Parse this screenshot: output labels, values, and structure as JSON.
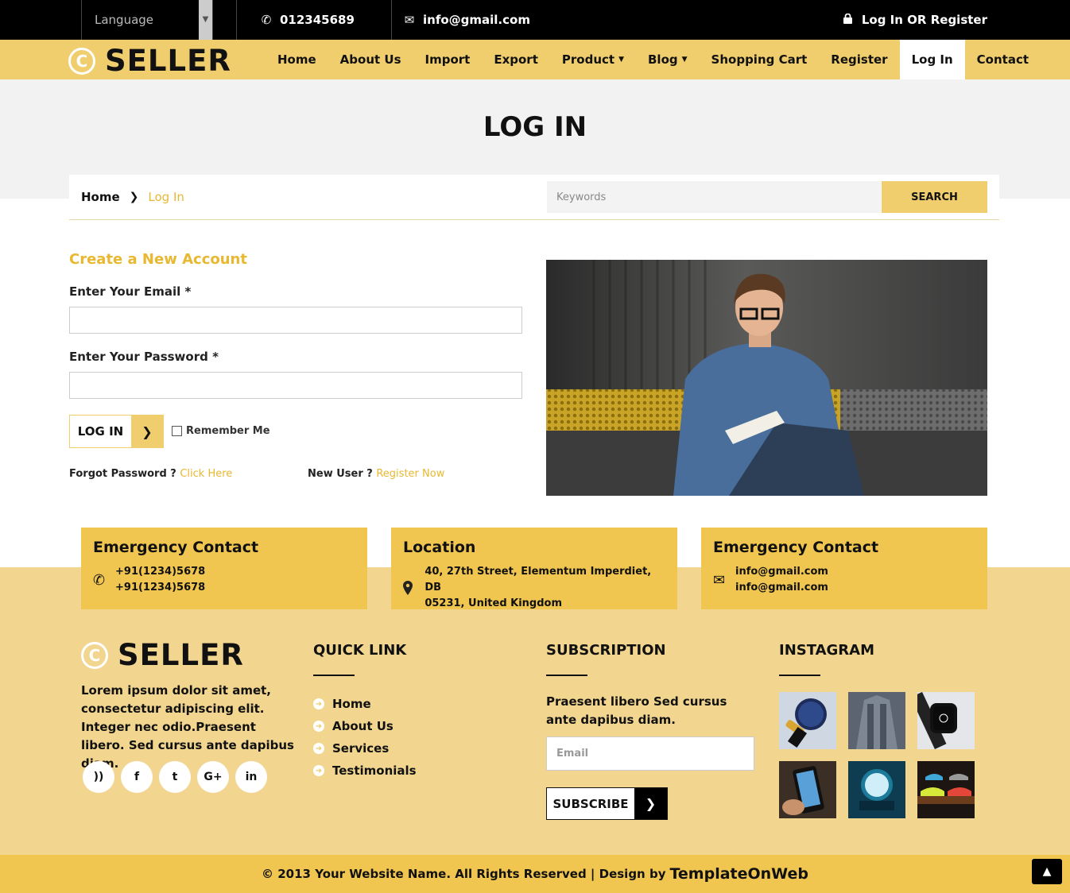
{
  "topbar": {
    "language_label": "Language",
    "phone": "012345689",
    "email": "info@gmail.com",
    "login_text": "Log In",
    "or_text": "OR",
    "register_text": "Register"
  },
  "brand": {
    "name": "SELLER",
    "mark": "C"
  },
  "nav": {
    "items": [
      {
        "label": "Home"
      },
      {
        "label": "About Us"
      },
      {
        "label": "Import"
      },
      {
        "label": "Export"
      },
      {
        "label": "Product"
      },
      {
        "label": "Blog"
      },
      {
        "label": "Shopping Cart"
      },
      {
        "label": "Register"
      },
      {
        "label": "Log In"
      },
      {
        "label": "Contact"
      }
    ]
  },
  "hero": {
    "title": "LOG IN"
  },
  "breadcrumb": {
    "home": "Home",
    "current": "Log In"
  },
  "search": {
    "placeholder": "Keywords",
    "button": "SEARCH"
  },
  "form": {
    "title": "Create a New Account",
    "email_label": "Enter Your Email",
    "password_label": "Enter Your Password",
    "required_mark": "*",
    "email_value": "",
    "password_value": "",
    "login_button": "LOG IN",
    "remember_label": "Remember Me",
    "forgot_text": "Forgot Password ?",
    "forgot_link": "Click Here",
    "new_user_text": "New User ?",
    "register_link": "Register Now"
  },
  "contact_cards": [
    {
      "title": "Emergency Contact",
      "icon": "phone-icon",
      "lines": [
        "+91(1234)5678",
        "+91(1234)5678"
      ]
    },
    {
      "title": "Location",
      "icon": "map-pin-icon",
      "lines": [
        "40, 27th Street, Elementum Imperdiet, DB",
        "05231, United Kingdom"
      ]
    },
    {
      "title": "Emergency Contact",
      "icon": "envelope-icon",
      "lines": [
        "info@gmail.com",
        "info@gmail.com"
      ]
    }
  ],
  "footer": {
    "about_text": "Lorem ipsum dolor sit amet, consectetur adipiscing elit. Integer nec odio.Praesent libero. Sed cursus ante dapibus diam.",
    "socials": [
      "rss-icon",
      "facebook-icon",
      "twitter-icon",
      "google-plus-icon",
      "linkedin-icon"
    ],
    "social_glyphs": {
      "rss": "))",
      "facebook": "f",
      "twitter": "t",
      "google": "G+",
      "linkedin": "in"
    },
    "quick_link_title": "QUICK LINK",
    "quick_links": [
      "Home",
      "About Us",
      "Services",
      "Testimonials"
    ],
    "subscription_title": "SUBSCRIPTION",
    "subscription_text": "Praesent libero Sed cursus ante dapibus diam.",
    "subscription_placeholder": "Email",
    "subscribe_button": "SUBSCRIBE",
    "instagram_title": "INSTAGRAM"
  },
  "copyright": {
    "text": "© 2013 Your Website Name. All Rights Reserved | Design by",
    "brand": "TemplateOnWeb"
  },
  "colors": {
    "accent": "#f0cd6d",
    "link": "#e8b830",
    "footer_bg": "#f2d68f",
    "card_bg": "#f0c550"
  }
}
